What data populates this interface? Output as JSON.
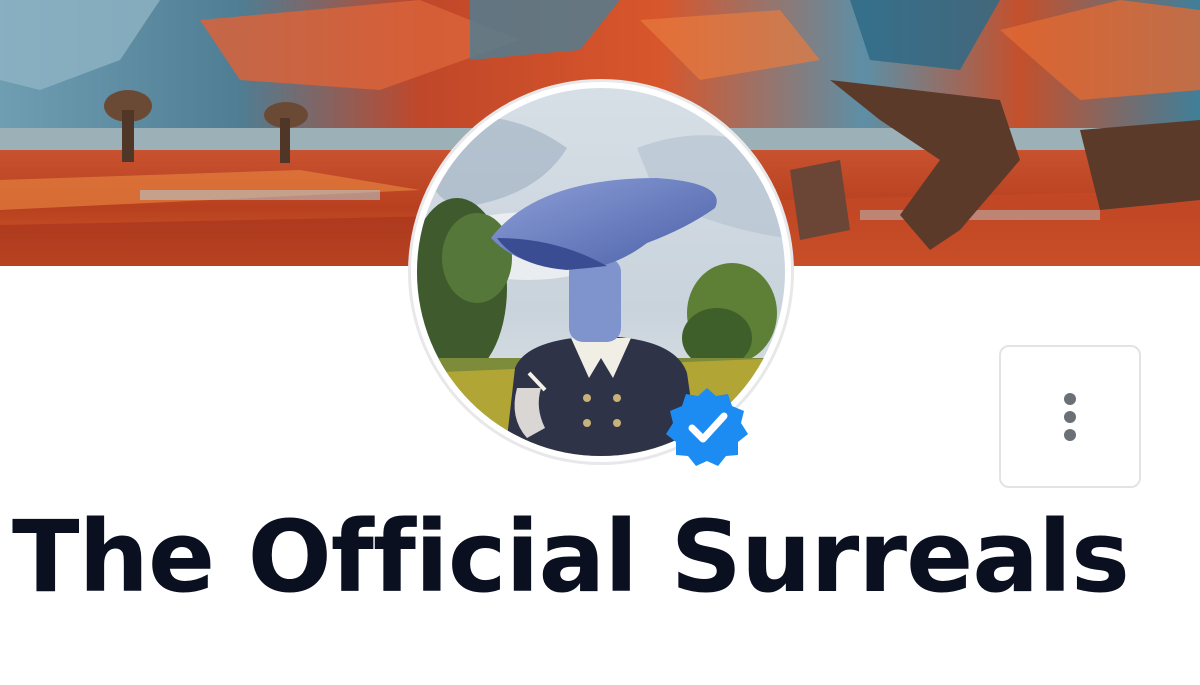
{
  "profile": {
    "name": "The Official Surreals",
    "verified": true
  },
  "banner": {
    "image": "surreal-landscape-painting"
  },
  "avatar": {
    "image": "mushroom-headed-figure-portrait"
  },
  "icons": {
    "verified": "verified-check-badge-icon",
    "more": "more-vertical-dots-icon"
  },
  "colors": {
    "verified_badge": "#1d8cf2",
    "name_text": "#0a1020",
    "button_border": "#e2e3e6",
    "dots": "#6b6f76"
  }
}
